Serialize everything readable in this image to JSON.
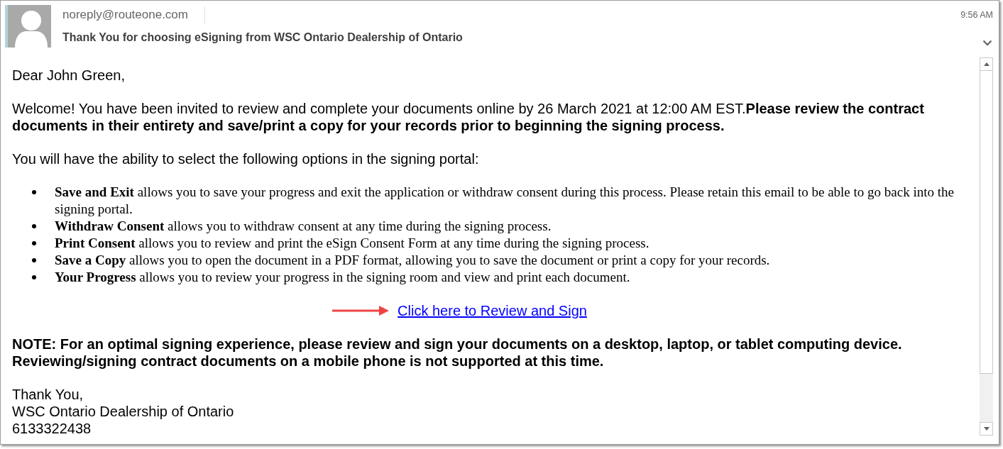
{
  "header": {
    "sender": "noreply@routeone.com",
    "subject": "Thank You for choosing eSigning from WSC Ontario Dealership of Ontario",
    "time": "9:56 AM"
  },
  "message": {
    "greeting": "Dear John Green,",
    "intro": "Welcome! You have been invited to review and complete your documents online by 26 March 2021 at 12:00 AM EST.**Please review the contract documents in their entirety and save/print a copy for your records prior to beginning the signing process.**",
    "options_intro": "You will have the ability to select the following options in the signing portal:",
    "options": [
      "**Save and Exit** allows you to save your progress and exit the application or withdraw consent during this process. Please retain this email to be able to go back into the signing portal.",
      "**Withdraw Consent** allows you to withdraw consent at any time during the signing process.",
      "**Print Consent** allows you to review and print the eSign Consent Form at any time during the signing process.",
      "**Save a Copy** allows you to open the document in a PDF format, allowing you to save the document or print a copy for your records.",
      "**Your Progress** allows you to review your progress in the signing room and view and print each document."
    ],
    "link": "Click here to Review and Sign",
    "note": "NOTE: For an optimal signing experience, please review and sign your documents on a desktop, laptop, or tablet computing device. Reviewing/signing contract documents on a mobile phone is not supported at this time.",
    "signature": [
      "Thank You,",
      "WSC Ontario Dealership of Ontario",
      "6133322438"
    ]
  }
}
